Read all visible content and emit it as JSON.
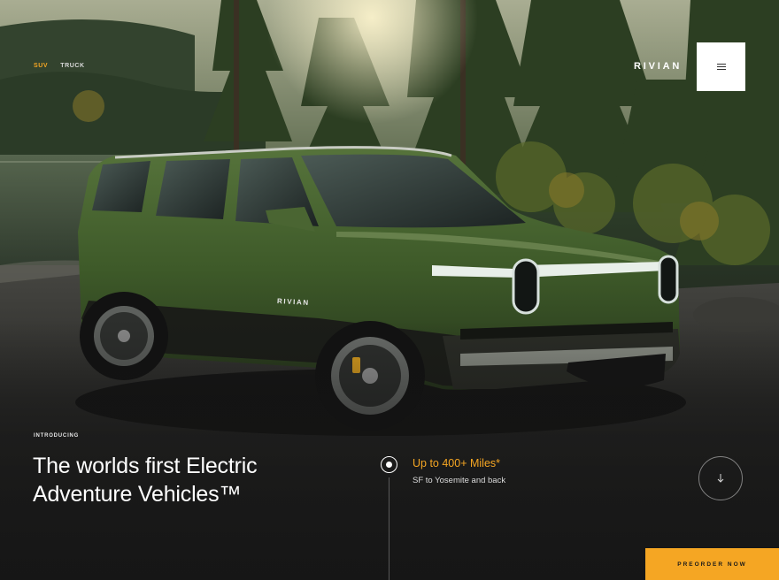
{
  "nav": {
    "tabs": [
      {
        "label": "SUV",
        "active": true
      },
      {
        "label": "TRUCK",
        "active": false
      }
    ],
    "brand": "RIVIAN",
    "menu_icon": "hamburger-menu-icon"
  },
  "hero": {
    "eyebrow": "INTRODUCING",
    "headline_line1": "The worlds first Electric",
    "headline_line2": "Adventure Vehicles™",
    "vehicle_badge": "RIVIAN"
  },
  "feature": {
    "title": "Up to 400+ Miles*",
    "subtitle": "SF to Yosemite and back",
    "icon": "radio-selected-icon"
  },
  "scroll": {
    "icon": "arrow-down-icon"
  },
  "cta": {
    "label": "PREORDER NOW"
  },
  "colors": {
    "accent": "#f5a623",
    "vehicle_body": "#3f5a2a",
    "background_dark": "#1b1d1c"
  }
}
